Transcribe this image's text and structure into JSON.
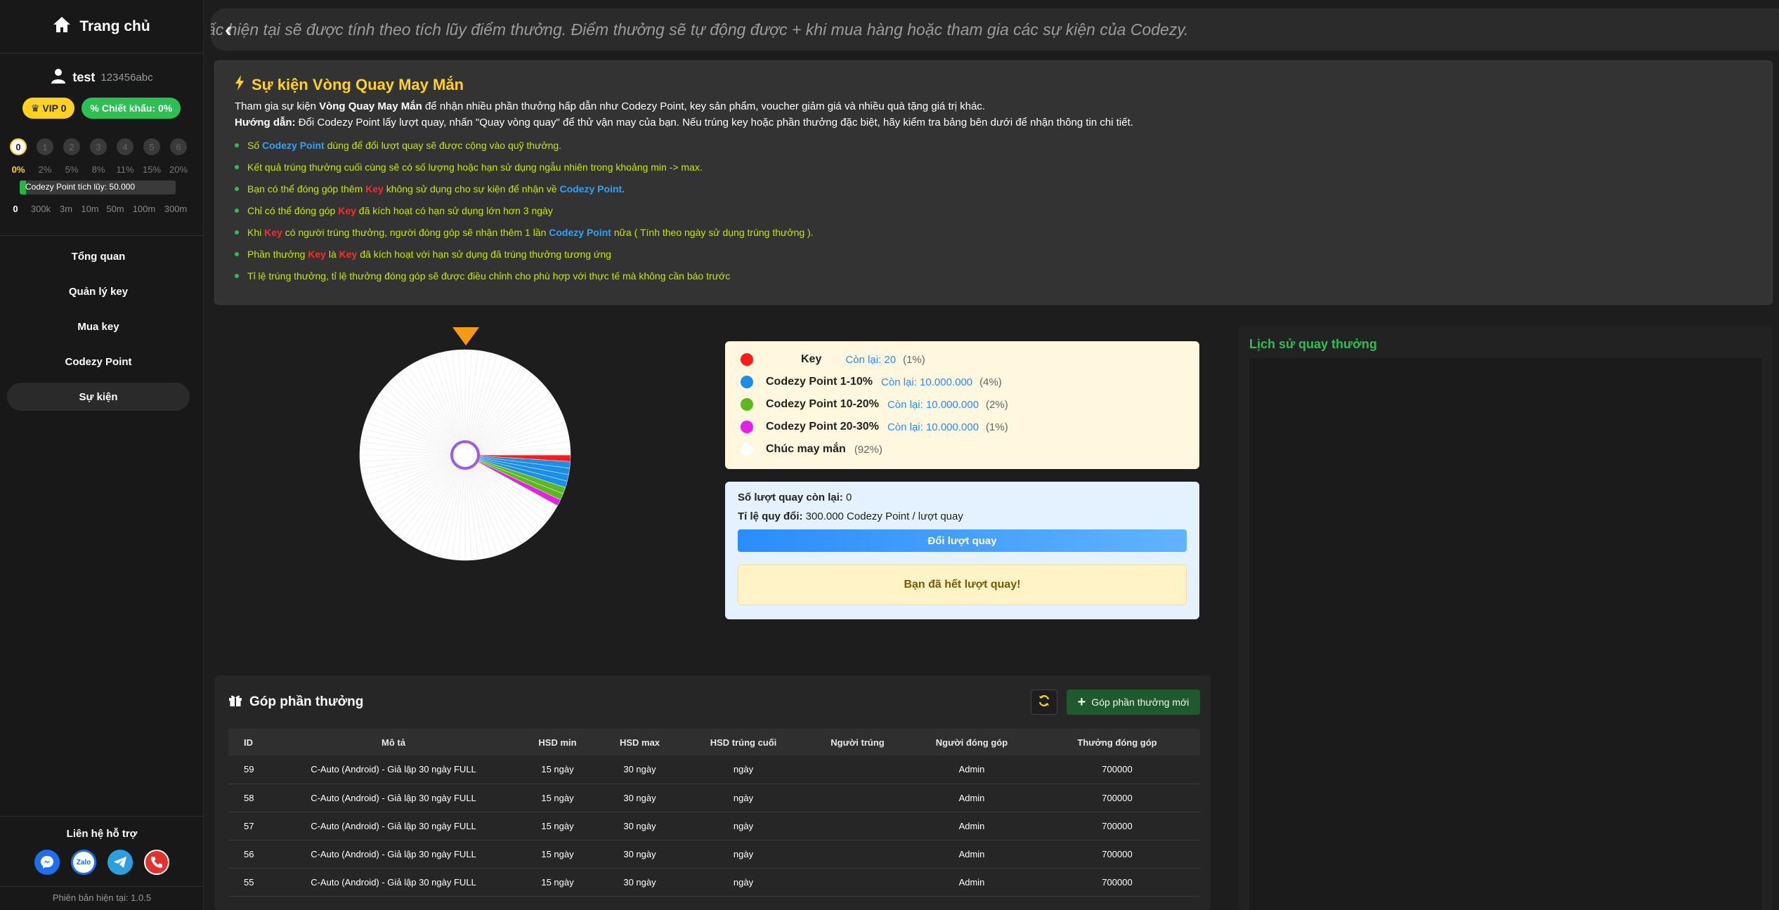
{
  "sidebar": {
    "home_label": "Trang chủ",
    "username": "test",
    "user_id": "123456abc",
    "vip_label": "VIP 0",
    "discount_label": "Chiết khấu: 0%",
    "levels": [
      "0",
      "1",
      "2",
      "3",
      "4",
      "5",
      "6"
    ],
    "level_percents": [
      "0%",
      "2%",
      "5%",
      "8%",
      "11%",
      "15%",
      "20%"
    ],
    "progress_fraction": 0.04,
    "progress_text": "Codezy Point tích lũy: 50.000",
    "thresholds": [
      "0",
      "300k",
      "3m",
      "10m",
      "50m",
      "100m",
      "300m"
    ],
    "nav": [
      "Tổng quan",
      "Quản lý key",
      "Mua key",
      "Codezy Point",
      "Sự kiện"
    ],
    "support_title": "Liên hệ hỗ trợ",
    "support_zalo": "Zalo",
    "version": "Phiên bản hiện tại: 1.0.5"
  },
  "marquee": {
    "text": "ấc hiện tại sẽ được tính theo tích lũy điểm thưởng. Điểm thưởng sẽ tự động được + khi mua hàng hoặc tham gia các sự kiện của Codezy."
  },
  "event": {
    "title": "Sự kiện Vòng Quay May Mắn",
    "intro_pre": "Tham gia sự kiện ",
    "intro_bold": "Vòng Quay May Mắn",
    "intro_post": " để nhận nhiều phần thưởng hấp dẫn như Codezy Point, key sản phẩm, voucher giảm giá và nhiều quà tặng giá trị khác.",
    "guide_label": "Hướng dẫn:",
    "guide_text": " Đổi Codezy Point lấy lượt quay, nhấn \"Quay vòng quay\" để thử vận may của bạn. Nếu trúng key hoặc phần thưởng đặc biệt, hãy kiểm tra bảng bên dưới để nhận thông tin chi tiết.",
    "rules": [
      {
        "a": "Số ",
        "b": "Codezy Point",
        "c": " dùng để đổi lượt quay sẽ được cộng vào quỹ thưởng."
      },
      {
        "a": "Kết quả trúng thưởng cuối cùng sẽ có số lượng hoặc hạn sử dụng ngẫu nhiên trong khoảng min -> max."
      },
      {
        "a": "Bạn có thể đóng góp thêm ",
        "k1": "Key",
        "c": " không sử dụng cho sự kiện để nhận về ",
        "b2": "Codezy Point",
        "d": "."
      },
      {
        "a": "Chỉ có thể đóng góp ",
        "k1": "Key",
        "c": " đã kích hoạt có hạn sử dụng lớn hơn 3 ngày"
      },
      {
        "a": "Khi ",
        "k1": "Key",
        "c": " có người trúng thưởng, người đóng góp sẽ nhận thêm 1 lần ",
        "b2": "Codezy Point",
        "d": " nữa ( Tính theo ngày sử dụng trúng thưởng )."
      },
      {
        "a": "Phần thưởng ",
        "k1": "Key",
        "c": " là ",
        "k2": "Key",
        "d": " đã kích hoạt với hạn sử dụng đã trúng thưởng tương ứng"
      },
      {
        "a": "Tỉ lệ trúng thưởng, tỉ lệ thưởng đóng góp sẽ được điều chỉnh cho phù hợp với thực tế mà không cần báo trước"
      }
    ]
  },
  "wheel": {
    "segments": [
      {
        "name": "Key",
        "percent": 1,
        "color": "#ff1a1a"
      },
      {
        "name": "Codezy Point 1-10%",
        "percent": 4,
        "color": "#1a8fe8"
      },
      {
        "name": "Codezy Point 10-20%",
        "percent": 2,
        "color": "#5cb81d"
      },
      {
        "name": "Codezy Point 20-30%",
        "percent": 1,
        "color": "#e61ee6"
      },
      {
        "name": "Chúc may mắn",
        "percent": 92,
        "color": "#ffffff"
      }
    ]
  },
  "legend": [
    {
      "name": "Key",
      "remain": "Còn lại: 20",
      "pct": "(1%)",
      "color": "#ff1a1a"
    },
    {
      "name": "Codezy Point 1-10%",
      "remain": "Còn lại: 10.000.000",
      "pct": "(4%)",
      "color": "#1a8fe8"
    },
    {
      "name": "Codezy Point 10-20%",
      "remain": "Còn lại: 10.000.000",
      "pct": "(2%)",
      "color": "#5cb81d"
    },
    {
      "name": "Codezy Point 20-30%",
      "remain": "Còn lại: 10.000.000",
      "pct": "(1%)",
      "color": "#e61ee6"
    },
    {
      "name": "Chúc may mắn",
      "remain": "",
      "pct": "(92%)",
      "color": "#ffffff"
    }
  ],
  "spin": {
    "remaining_label": "Số lượt quay còn lại:",
    "remaining_value": " 0",
    "rate_label": "Tỉ lệ quy đổi:",
    "rate_value": " 300.000 Codezy Point / lượt quay",
    "exchange_button": "Đổi lượt quay",
    "out_message": "Bạn đã hết lượt quay!"
  },
  "history": {
    "title": "Lịch sử quay thưởng"
  },
  "contrib": {
    "title": "Góp phần thưởng",
    "add_button": "Góp phần thưởng mới",
    "columns": [
      "ID",
      "Mô tả",
      "HSD min",
      "HSD max",
      "HSD trúng cuối",
      "Người trúng",
      "Người đóng góp",
      "Thưởng đóng góp"
    ],
    "rows": [
      [
        "59",
        "C-Auto (Android) - Giả lập 30 ngày FULL",
        "15 ngày",
        "30 ngày",
        "ngày",
        "",
        "Admin",
        "700000"
      ],
      [
        "58",
        "C-Auto (Android) - Giả lập 30 ngày FULL",
        "15 ngày",
        "30 ngày",
        "ngày",
        "",
        "Admin",
        "700000"
      ],
      [
        "57",
        "C-Auto (Android) - Giả lập 30 ngày FULL",
        "15 ngày",
        "30 ngày",
        "ngày",
        "",
        "Admin",
        "700000"
      ],
      [
        "56",
        "C-Auto (Android) - Giả lập 30 ngày FULL",
        "15 ngày",
        "30 ngày",
        "ngày",
        "",
        "Admin",
        "700000"
      ],
      [
        "55",
        "C-Auto (Android) - Giả lập 30 ngày FULL",
        "15 ngày",
        "30 ngày",
        "ngày",
        "",
        "Admin",
        "700000"
      ]
    ]
  }
}
